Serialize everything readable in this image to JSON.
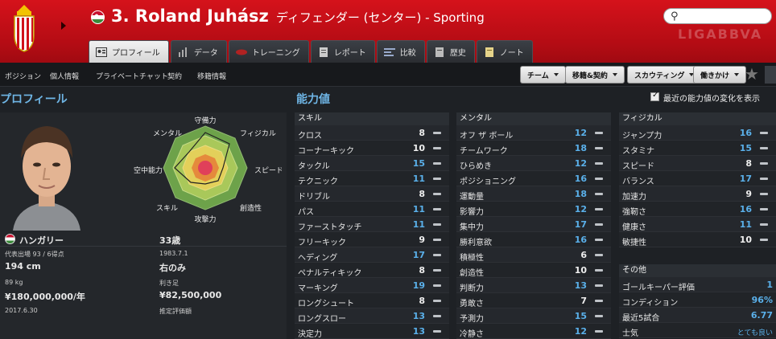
{
  "header": {
    "player_number_name": "3. Roland Juhász",
    "role_club": "ディフェンダー (センター) - Sporting",
    "search_placeholder": "",
    "brand_watermark": "LIGABBVA"
  },
  "tabs": [
    {
      "label": "プロフィール",
      "icon": "profile-icon",
      "active": true
    },
    {
      "label": "データ",
      "icon": "stats-icon"
    },
    {
      "label": "トレーニング",
      "icon": "training-icon"
    },
    {
      "label": "レポート",
      "icon": "report-icon"
    },
    {
      "label": "比較",
      "icon": "compare-icon"
    },
    {
      "label": "歴史",
      "icon": "history-icon"
    },
    {
      "label": "ノート",
      "icon": "notes-icon"
    }
  ],
  "subnav": [
    "ポジション",
    "個人情報",
    "プライベートチャット",
    "契約",
    "移籍情報"
  ],
  "dropdowns": [
    "チーム",
    "移籍&契約",
    "スカウティング",
    "働きかけ"
  ],
  "profile": {
    "section_title": "プロフィール",
    "radar_labels": {
      "top": "守備力",
      "top_right": "フィジカル",
      "right": "スピード",
      "bottom_right": "創造性",
      "bottom": "攻撃力",
      "bottom_left": "スキル",
      "left": "空中能力",
      "top_left": "メンタル"
    },
    "nationality": "ハンガリー",
    "age": "33歳",
    "caps": "代表出場 93 / 6得点",
    "birthdate": "1983.7.1",
    "height": "194 cm",
    "foot": "右のみ",
    "weight": "89 kg",
    "preferred_foot_label": "利き足",
    "wage": "¥180,000,000/年",
    "value": "¥82,500,000",
    "contract_end": "2017.6.30",
    "value_label": "推定評価額"
  },
  "attributes": {
    "section_title": "能力値",
    "show_changes_label": "最近の能力値の変化を表示",
    "skill": {
      "title": "スキル",
      "items": [
        {
          "label": "クロス",
          "value": "8"
        },
        {
          "label": "コーナーキック",
          "value": "10"
        },
        {
          "label": "タックル",
          "value": "15",
          "hi": true
        },
        {
          "label": "テクニック",
          "value": "11",
          "hi": true
        },
        {
          "label": "ドリブル",
          "value": "8"
        },
        {
          "label": "パス",
          "value": "11",
          "hi": true
        },
        {
          "label": "ファーストタッチ",
          "value": "11",
          "hi": true
        },
        {
          "label": "フリーキック",
          "value": "9"
        },
        {
          "label": "ヘディング",
          "value": "17",
          "hi": true
        },
        {
          "label": "ペナルティキック",
          "value": "8"
        },
        {
          "label": "マーキング",
          "value": "19",
          "hi": true
        },
        {
          "label": "ロングシュート",
          "value": "8"
        },
        {
          "label": "ロングスロー",
          "value": "13",
          "hi": true
        },
        {
          "label": "決定力",
          "value": "13",
          "hi": true
        }
      ]
    },
    "mental": {
      "title": "メンタル",
      "items": [
        {
          "label": "オフ ザ ボール",
          "value": "12",
          "hi": true
        },
        {
          "label": "チームワーク",
          "value": "18",
          "hi": true
        },
        {
          "label": "ひらめき",
          "value": "12",
          "hi": true
        },
        {
          "label": "ポジショニング",
          "value": "16",
          "hi": true
        },
        {
          "label": "運動量",
          "value": "18",
          "hi": true
        },
        {
          "label": "影響力",
          "value": "12",
          "hi": true
        },
        {
          "label": "集中力",
          "value": "17",
          "hi": true
        },
        {
          "label": "勝利意欲",
          "value": "16",
          "hi": true
        },
        {
          "label": "積極性",
          "value": "6"
        },
        {
          "label": "創造性",
          "value": "10"
        },
        {
          "label": "判断力",
          "value": "13",
          "hi": true
        },
        {
          "label": "勇敢さ",
          "value": "7"
        },
        {
          "label": "予測力",
          "value": "15",
          "hi": true
        },
        {
          "label": "冷静さ",
          "value": "12",
          "hi": true
        }
      ]
    },
    "physical": {
      "title": "フィジカル",
      "items": [
        {
          "label": "ジャンプ力",
          "value": "16",
          "hi": true
        },
        {
          "label": "スタミナ",
          "value": "15",
          "hi": true
        },
        {
          "label": "スピード",
          "value": "8"
        },
        {
          "label": "バランス",
          "value": "17",
          "hi": true
        },
        {
          "label": "加速力",
          "value": "9"
        },
        {
          "label": "強靭さ",
          "value": "16",
          "hi": true
        },
        {
          "label": "健康さ",
          "value": "11",
          "hi": true
        },
        {
          "label": "敏捷性",
          "value": "10"
        }
      ]
    },
    "other": {
      "title": "その他",
      "items": [
        {
          "label": "ゴールキーパー評価",
          "value": "1"
        },
        {
          "label": "コンディション",
          "value": "96%"
        },
        {
          "label": "最近5試合",
          "value": "6.77"
        },
        {
          "label": "士気",
          "value": "とても良い"
        }
      ]
    }
  }
}
